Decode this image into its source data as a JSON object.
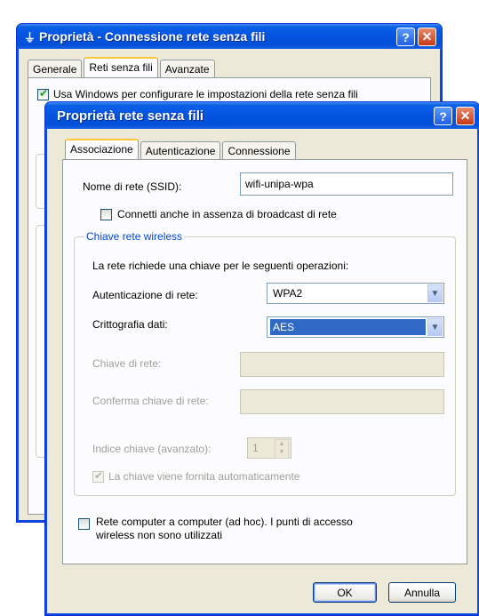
{
  "back_window": {
    "title": "Proprietà - Connessione rete senza fili",
    "tabs": [
      "Generale",
      "Reti senza fili",
      "Avanzate"
    ],
    "active_tab": 1,
    "partial_text": "Usa Windows per configurare le impostazioni della rete senza fili"
  },
  "dialog": {
    "title": "Proprietà rete senza fili",
    "help_label": "?",
    "close_label": "✕",
    "tabs": [
      "Associazione",
      "Autenticazione",
      "Connessione"
    ],
    "active_tab": 0,
    "ssid_label": "Nome di rete (SSID):",
    "ssid_value": "wifi-unipa-wpa",
    "broadcast_label": "Connetti anche in assenza di broadcast di rete",
    "broadcast_checked": false,
    "group_title": "Chiave rete wireless",
    "group_desc": "La rete richiede una chiave per le seguenti operazioni:",
    "auth_label": "Autenticazione di rete:",
    "auth_value": "WPA2",
    "crypto_label": "Crittografia dati:",
    "crypto_value": "AES",
    "key_label": "Chiave di rete:",
    "key_value": "",
    "confirm_label": "Conferma chiave di rete:",
    "confirm_value": "",
    "index_label": "Indice chiave (avanzato):",
    "index_value": "1",
    "auto_key_label": "La chiave viene fornita automaticamente",
    "auto_key_checked": true,
    "adhoc_label_1": "Rete computer a computer (ad hoc). I punti di accesso",
    "adhoc_label_2": "wireless non sono utilizzati",
    "adhoc_checked": false,
    "ok_label": "OK",
    "cancel_label": "Annulla"
  },
  "colors": {
    "titlebar": "#0453e0",
    "window_bg": "#ece9d8",
    "selection": "#316ac5",
    "group_title": "#0046d5"
  }
}
